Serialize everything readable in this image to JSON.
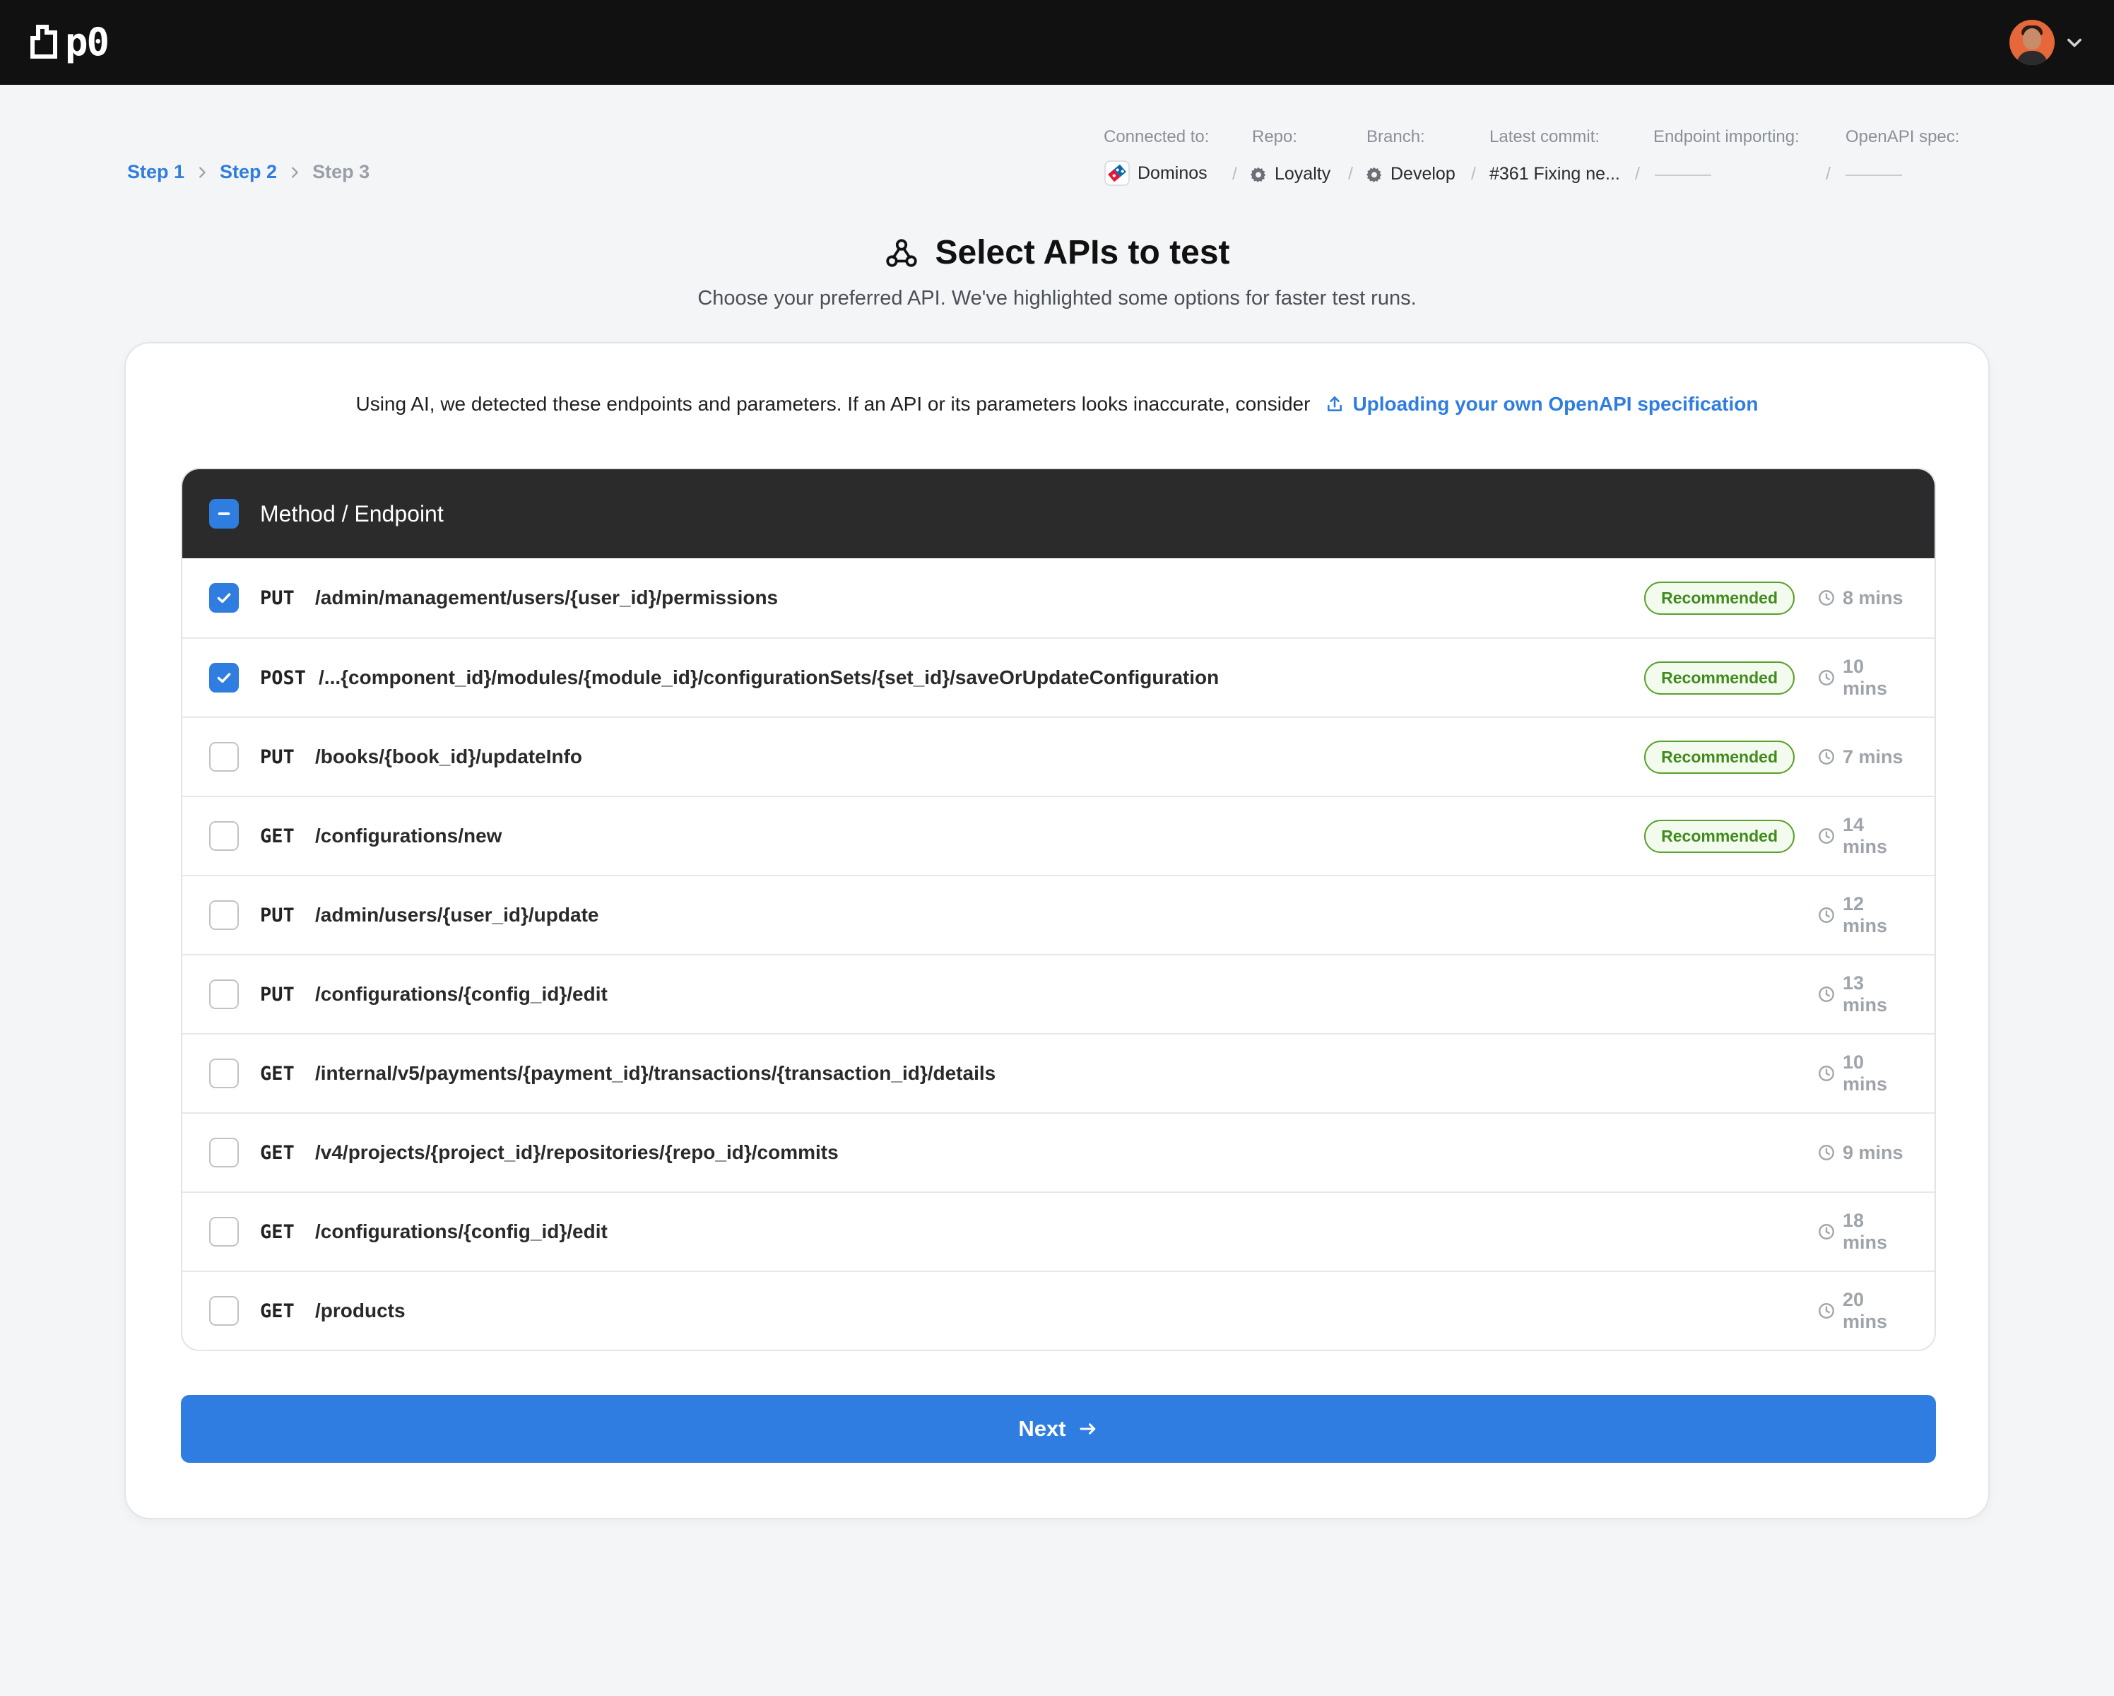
{
  "app": {
    "logo_text": "p0"
  },
  "breadcrumb": {
    "steps": [
      {
        "label": "Step 1"
      },
      {
        "label": "Step 2"
      },
      {
        "label": "Step 3"
      }
    ]
  },
  "connection": {
    "connected_label": "Connected to:",
    "connected_value": "Dominos",
    "repo_label": "Repo:",
    "repo_value": "Loyalty",
    "branch_label": "Branch:",
    "branch_value": "Develop",
    "commit_label": "Latest commit:",
    "commit_value": "#361 Fixing ne...",
    "endpoint_label": "Endpoint importing:",
    "openapi_label": "OpenAPI spec:"
  },
  "page": {
    "title": "Select APIs to test",
    "subtitle": "Choose your preferred API. We've highlighted some options for faster test runs."
  },
  "notice": {
    "text": "Using AI, we detected these endpoints and parameters. If an API or its parameters looks inaccurate, consider",
    "link_label": "Uploading your own OpenAPI specification"
  },
  "table": {
    "header_label": "Method / Endpoint",
    "recommended_label": "Recommended",
    "rows": [
      {
        "method": "PUT",
        "endpoint": "/admin/management/users/{user_id}/permissions",
        "checked": true,
        "recommended": true,
        "duration": "8 mins"
      },
      {
        "method": "POST",
        "endpoint": "/...{component_id}/modules/{module_id}/configurationSets/{set_id}/saveOrUpdateConfiguration",
        "checked": true,
        "recommended": true,
        "duration": "10 mins"
      },
      {
        "method": "PUT",
        "endpoint": "/books/{book_id}/updateInfo",
        "checked": false,
        "recommended": true,
        "duration": "7 mins"
      },
      {
        "method": "GET",
        "endpoint": "/configurations/new",
        "checked": false,
        "recommended": true,
        "duration": "14 mins"
      },
      {
        "method": "PUT",
        "endpoint": "/admin/users/{user_id}/update",
        "checked": false,
        "recommended": false,
        "duration": "12 mins"
      },
      {
        "method": "PUT",
        "endpoint": "/configurations/{config_id}/edit",
        "checked": false,
        "recommended": false,
        "duration": "13 mins"
      },
      {
        "method": "GET",
        "endpoint": "/internal/v5/payments/{payment_id}/transactions/{transaction_id}/details",
        "checked": false,
        "recommended": false,
        "duration": "10 mins"
      },
      {
        "method": "GET",
        "endpoint": "/v4/projects/{project_id}/repositories/{repo_id}/commits",
        "checked": false,
        "recommended": false,
        "duration": "9 mins"
      },
      {
        "method": "GET",
        "endpoint": "/configurations/{config_id}/edit",
        "checked": false,
        "recommended": false,
        "duration": "18 mins"
      },
      {
        "method": "GET",
        "endpoint": "/products",
        "checked": false,
        "recommended": false,
        "duration": "20 mins"
      }
    ]
  },
  "next_button": {
    "label": "Next"
  },
  "colors": {
    "accent": "#2f7de0",
    "topbar": "#111111",
    "recommended": "#3f8b1c"
  },
  "icons": [
    "logo-icon",
    "avatar",
    "chevron-down-icon",
    "chevron-right-icon",
    "dominos-logo",
    "gear-icon",
    "webhook-icon",
    "upload-icon",
    "check-icon",
    "minus-icon",
    "clock-icon",
    "arrow-right-icon"
  ]
}
